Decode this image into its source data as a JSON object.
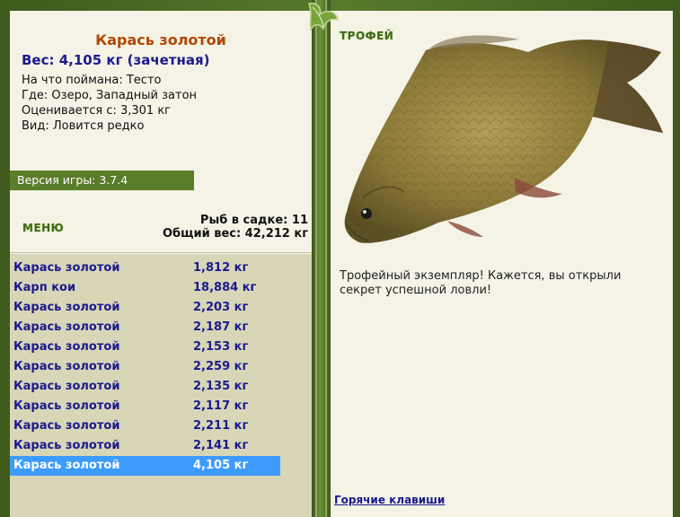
{
  "catch": {
    "title": "Карась золотой",
    "weight_line": "Вес: 4,105 кг (зачетная)",
    "bait": "На что поймана: Тесто",
    "place": "Где: Озеро, Западный затон",
    "value": "Оценивается с: 3,301 кг",
    "rarity": "Вид: Ловится редко"
  },
  "version": "Версия игры: 3.7.4",
  "menu_label": "МЕНЮ",
  "keepnet": {
    "count_line": "Рыб в садке: 11",
    "total_line": "Общий вес: 42,212 кг"
  },
  "fish_list": [
    {
      "name": "Карась золотой",
      "weight": "1,812 кг"
    },
    {
      "name": "Карп кои",
      "weight": "18,884 кг"
    },
    {
      "name": "Карась золотой",
      "weight": "2,203 кг"
    },
    {
      "name": "Карась золотой",
      "weight": "2,187 кг"
    },
    {
      "name": "Карась золотой",
      "weight": "2,153 кг"
    },
    {
      "name": "Карась золотой",
      "weight": "2,259 кг"
    },
    {
      "name": "Карась золотой",
      "weight": "2,135 кг"
    },
    {
      "name": "Карась золотой",
      "weight": "2,117 кг"
    },
    {
      "name": "Карась золотой",
      "weight": "2,211 кг"
    },
    {
      "name": "Карась золотой",
      "weight": "2,141 кг"
    },
    {
      "name": "Карась золотой",
      "weight": "4,105 кг"
    }
  ],
  "selected_index": 10,
  "trophy_label": "ТРОФЕЙ",
  "trophy_message": "Трофейный экземпляр! Кажется, вы открыли секрет успешной ловли!",
  "hotkeys_link": "Горячие клавиши",
  "colors": {
    "accent_green": "#5a7d2a",
    "selection": "#3d9bff",
    "title": "#b34700",
    "link": "#1a1a8c"
  }
}
